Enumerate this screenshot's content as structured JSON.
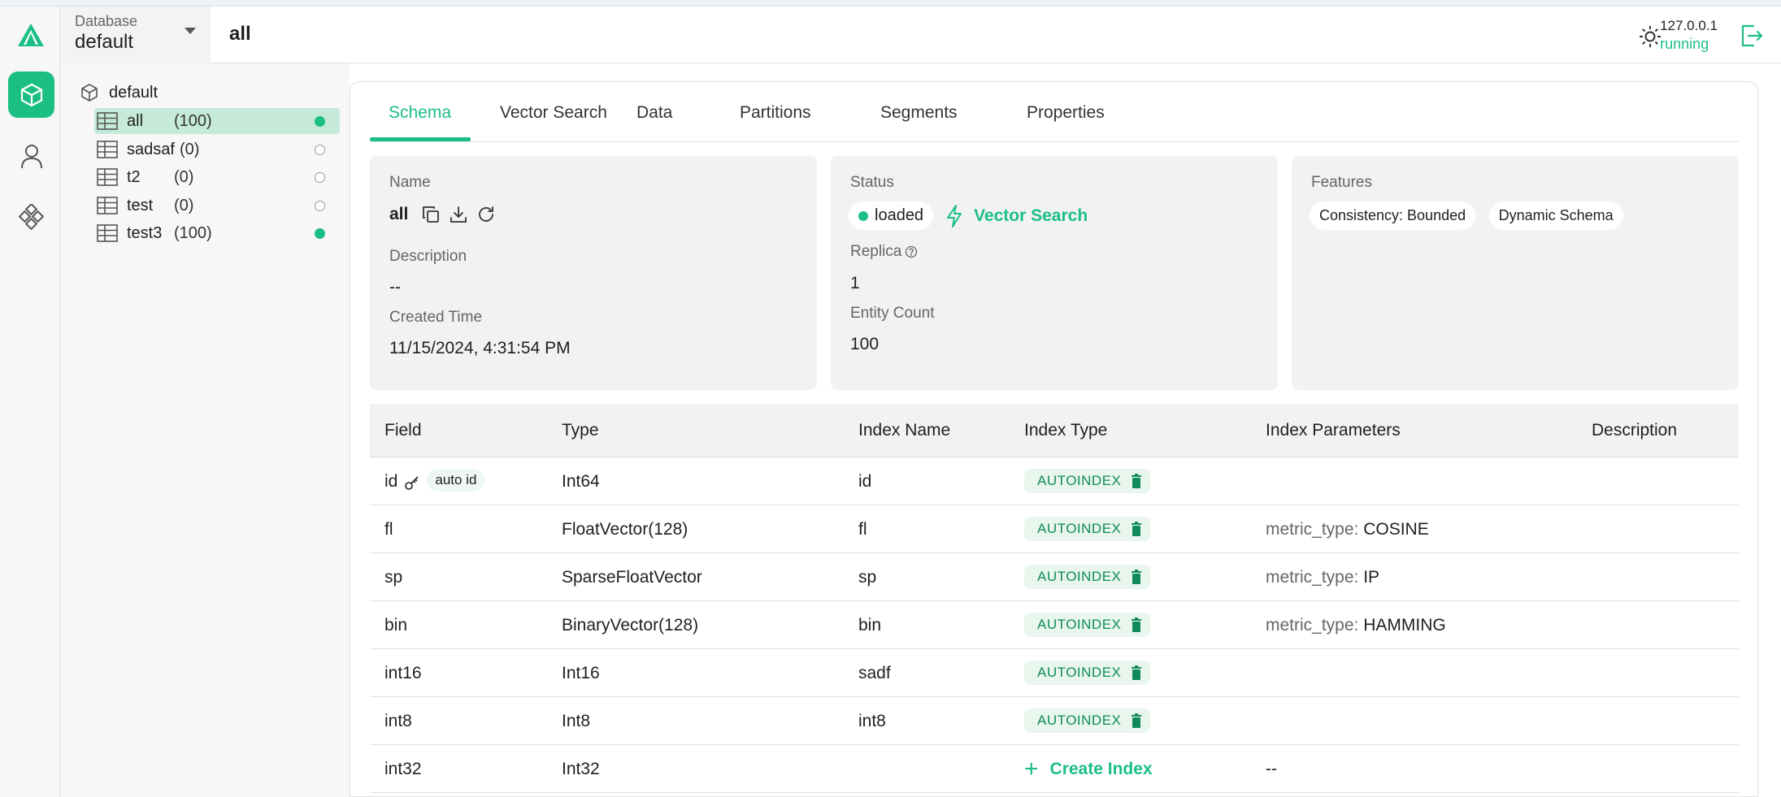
{
  "header": {
    "database_label": "Database",
    "database_value": "default",
    "collection_title": "all",
    "host": "127.0.0.1",
    "status": "running"
  },
  "nav": {
    "items": [
      {
        "icon": "collection-cube-icon",
        "active": true
      },
      {
        "icon": "user-icon",
        "active": false
      },
      {
        "icon": "system-diamond-icon",
        "active": false
      }
    ]
  },
  "tree": {
    "root": "default",
    "collections": [
      {
        "name": "all",
        "count": "(100)",
        "loaded": true,
        "selected": true
      },
      {
        "name": "sadsaf",
        "count": "(0)",
        "loaded": false,
        "selected": false
      },
      {
        "name": "t2",
        "count": "(0)",
        "loaded": false,
        "selected": false
      },
      {
        "name": "test",
        "count": "(0)",
        "loaded": false,
        "selected": false
      },
      {
        "name": "test3",
        "count": "(100)",
        "loaded": true,
        "selected": false
      }
    ]
  },
  "tabs": [
    "Schema",
    "Vector Search",
    "Data",
    "Partitions",
    "Segments",
    "Properties"
  ],
  "active_tab": "Schema",
  "info": {
    "name_label": "Name",
    "name_value": "all",
    "description_label": "Description",
    "description_value": "--",
    "created_label": "Created Time",
    "created_value": "11/15/2024, 4:31:54 PM",
    "status_label": "Status",
    "status_value": "loaded",
    "vector_search_link": "Vector Search",
    "replica_label": "Replica",
    "replica_value": "1",
    "entity_label": "Entity Count",
    "entity_value": "100",
    "features_label": "Features",
    "features": [
      "Consistency: Bounded",
      "Dynamic Schema"
    ]
  },
  "schema_table": {
    "headers": [
      "Field",
      "Type",
      "Index Name",
      "Index Type",
      "Index Parameters",
      "Description"
    ],
    "rows": [
      {
        "field": "id",
        "primary_key": true,
        "auto_id": "auto id",
        "type": "Int64",
        "index_name": "id",
        "index_type": "AUTOINDEX",
        "param_key": "",
        "param_value": "",
        "description": ""
      },
      {
        "field": "fl",
        "primary_key": false,
        "auto_id": "",
        "type": "FloatVector(128)",
        "index_name": "fl",
        "index_type": "AUTOINDEX",
        "param_key": "metric_type:",
        "param_value": "COSINE",
        "description": ""
      },
      {
        "field": "sp",
        "primary_key": false,
        "auto_id": "",
        "type": "SparseFloatVector",
        "index_name": "sp",
        "index_type": "AUTOINDEX",
        "param_key": "metric_type:",
        "param_value": "IP",
        "description": ""
      },
      {
        "field": "bin",
        "primary_key": false,
        "auto_id": "",
        "type": "BinaryVector(128)",
        "index_name": "bin",
        "index_type": "AUTOINDEX",
        "param_key": "metric_type:",
        "param_value": "HAMMING",
        "description": ""
      },
      {
        "field": "int16",
        "primary_key": false,
        "auto_id": "",
        "type": "Int16",
        "index_name": "sadf",
        "index_type": "AUTOINDEX",
        "param_key": "",
        "param_value": "",
        "description": ""
      },
      {
        "field": "int8",
        "primary_key": false,
        "auto_id": "",
        "type": "Int8",
        "index_name": "int8",
        "index_type": "AUTOINDEX",
        "param_key": "",
        "param_value": "",
        "description": ""
      },
      {
        "field": "int32",
        "primary_key": false,
        "auto_id": "",
        "type": "Int32",
        "index_name": "",
        "index_type": "",
        "create_index": "Create Index",
        "param_key": "",
        "param_value": "--",
        "description": ""
      }
    ]
  },
  "colors": {
    "accent": "#1bbf84",
    "selected_bg": "#c6ead9",
    "badge_bg": "#e8f6ee"
  }
}
